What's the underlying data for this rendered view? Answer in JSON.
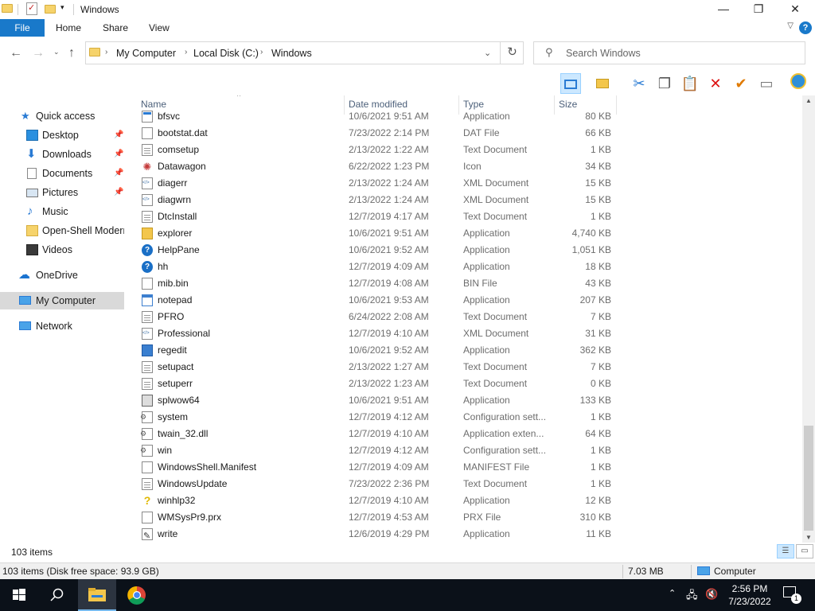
{
  "window": {
    "title": "Windows",
    "controls": {
      "minimize": "—",
      "maximize": "❐",
      "close": "✕"
    }
  },
  "ribbon": {
    "tabs": [
      "File",
      "Home",
      "Share",
      "View"
    ],
    "help": "?"
  },
  "address": {
    "crumbs": [
      "My Computer",
      "Local Disk (C:)",
      "Windows"
    ],
    "search_placeholder": "Search Windows"
  },
  "navigation": {
    "quick_access": "Quick access",
    "pinned": [
      {
        "label": "Desktop",
        "icon": "desktop-icon",
        "pinned": true
      },
      {
        "label": "Downloads",
        "icon": "downloads-icon",
        "pinned": true
      },
      {
        "label": "Documents",
        "icon": "documents-icon",
        "pinned": true
      },
      {
        "label": "Pictures",
        "icon": "pictures-icon",
        "pinned": true
      },
      {
        "label": "Music",
        "icon": "music-icon",
        "pinned": false
      },
      {
        "label": "Open-Shell Modern",
        "icon": "folder-icon",
        "pinned": false
      },
      {
        "label": "Videos",
        "icon": "videos-icon",
        "pinned": false
      }
    ],
    "onedrive": "OneDrive",
    "my_computer": "My Computer",
    "network": "Network"
  },
  "columns": {
    "name": "Name",
    "date": "Date modified",
    "type": "Type",
    "size": "Size"
  },
  "files": [
    {
      "name": "bfsvc",
      "date": "10/6/2021 9:51 AM",
      "type": "Application",
      "size": "80 KB",
      "icon": "app"
    },
    {
      "name": "bootstat.dat",
      "date": "7/23/2022 2:14 PM",
      "type": "DAT File",
      "size": "66 KB",
      "icon": "blank"
    },
    {
      "name": "comsetup",
      "date": "2/13/2022 1:22 AM",
      "type": "Text Document",
      "size": "1 KB",
      "icon": "doc"
    },
    {
      "name": "Datawagon",
      "date": "6/22/2022 1:23 PM",
      "type": "Icon",
      "size": "34 KB",
      "icon": "star"
    },
    {
      "name": "diagerr",
      "date": "2/13/2022 1:24 AM",
      "type": "XML Document",
      "size": "15 KB",
      "icon": "xml"
    },
    {
      "name": "diagwrn",
      "date": "2/13/2022 1:24 AM",
      "type": "XML Document",
      "size": "15 KB",
      "icon": "xml"
    },
    {
      "name": "DtcInstall",
      "date": "12/7/2019 4:17 AM",
      "type": "Text Document",
      "size": "1 KB",
      "icon": "doc"
    },
    {
      "name": "explorer",
      "date": "10/6/2021 9:51 AM",
      "type": "Application",
      "size": "4,740 KB",
      "icon": "folderapp"
    },
    {
      "name": "HelpPane",
      "date": "10/6/2021 9:52 AM",
      "type": "Application",
      "size": "1,051 KB",
      "icon": "help"
    },
    {
      "name": "hh",
      "date": "12/7/2019 4:09 AM",
      "type": "Application",
      "size": "18 KB",
      "icon": "help"
    },
    {
      "name": "mib.bin",
      "date": "12/7/2019 4:08 AM",
      "type": "BIN File",
      "size": "43 KB",
      "icon": "blank"
    },
    {
      "name": "notepad",
      "date": "10/6/2021 9:53 AM",
      "type": "Application",
      "size": "207 KB",
      "icon": "notepad"
    },
    {
      "name": "PFRO",
      "date": "6/24/2022 2:08 AM",
      "type": "Text Document",
      "size": "7 KB",
      "icon": "doc"
    },
    {
      "name": "Professional",
      "date": "12/7/2019 4:10 AM",
      "type": "XML Document",
      "size": "31 KB",
      "icon": "xml"
    },
    {
      "name": "regedit",
      "date": "10/6/2021 9:52 AM",
      "type": "Application",
      "size": "362 KB",
      "icon": "reg"
    },
    {
      "name": "setupact",
      "date": "2/13/2022 1:27 AM",
      "type": "Text Document",
      "size": "7 KB",
      "icon": "doc"
    },
    {
      "name": "setuperr",
      "date": "2/13/2022 1:23 AM",
      "type": "Text Document",
      "size": "0 KB",
      "icon": "doc"
    },
    {
      "name": "splwow64",
      "date": "10/6/2021 9:51 AM",
      "type": "Application",
      "size": "133 KB",
      "icon": "print"
    },
    {
      "name": "system",
      "date": "12/7/2019 4:12 AM",
      "type": "Configuration sett...",
      "size": "1 KB",
      "icon": "cfg"
    },
    {
      "name": "twain_32.dll",
      "date": "12/7/2019 4:10 AM",
      "type": "Application exten...",
      "size": "64 KB",
      "icon": "cfg"
    },
    {
      "name": "win",
      "date": "12/7/2019 4:12 AM",
      "type": "Configuration sett...",
      "size": "1 KB",
      "icon": "cfg"
    },
    {
      "name": "WindowsShell.Manifest",
      "date": "12/7/2019 4:09 AM",
      "type": "MANIFEST File",
      "size": "1 KB",
      "icon": "blank"
    },
    {
      "name": "WindowsUpdate",
      "date": "7/23/2022 2:36 PM",
      "type": "Text Document",
      "size": "1 KB",
      "icon": "doc"
    },
    {
      "name": "winhlp32",
      "date": "12/7/2019 4:10 AM",
      "type": "Application",
      "size": "12 KB",
      "icon": "q"
    },
    {
      "name": "WMSysPr9.prx",
      "date": "12/7/2019 4:53 AM",
      "type": "PRX File",
      "size": "310 KB",
      "icon": "blank"
    },
    {
      "name": "write",
      "date": "12/6/2019 4:29 PM",
      "type": "Application",
      "size": "11 KB",
      "icon": "write"
    }
  ],
  "status": {
    "item_count": "103 items",
    "disk_info": "103 items (Disk free space: 93.9 GB)",
    "size": "7.03 MB",
    "location": "Computer"
  },
  "taskbar": {
    "time": "2:56 PM",
    "date": "7/23/2022",
    "notification_count": "1"
  },
  "colors": {
    "accent": "#1979ca",
    "taskbar": "#0b1119",
    "selected_nav": "#d9d9d9"
  }
}
